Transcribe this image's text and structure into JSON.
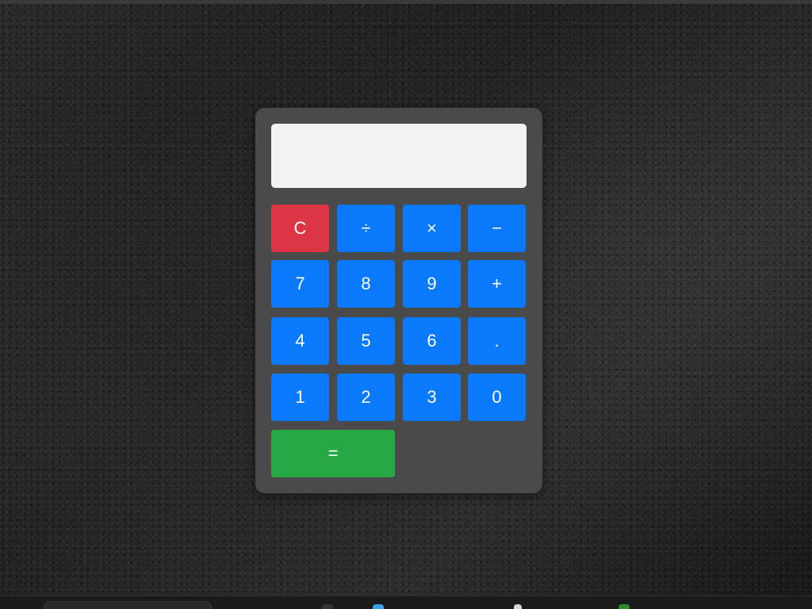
{
  "calculator": {
    "display_value": "",
    "colors": {
      "body": "#4a4a4a",
      "display": "#f3f3f3",
      "number_key": "#0b79fb",
      "clear_key": "#dc3545",
      "equals_key": "#28a745"
    },
    "keys": {
      "clear": "C",
      "divide": "÷",
      "multiply": "×",
      "subtract": "−",
      "seven": "7",
      "eight": "8",
      "nine": "9",
      "add": "+",
      "four": "4",
      "five": "5",
      "six": "6",
      "decimal": ".",
      "one": "1",
      "two": "2",
      "three": "3",
      "zero": "0",
      "equals": "="
    }
  }
}
